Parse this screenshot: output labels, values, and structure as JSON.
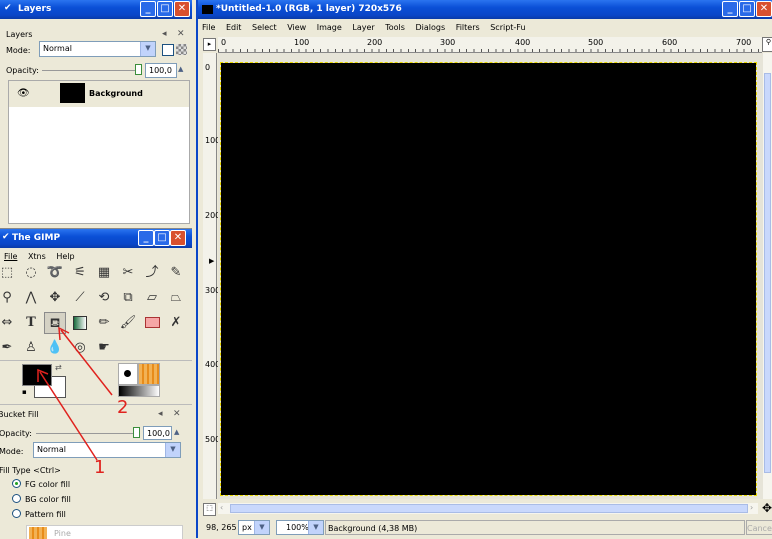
{
  "layers_window": {
    "title": "Layers",
    "header": "Layers",
    "mode_label": "Mode:",
    "mode_value": "Normal",
    "opacity_label": "Opacity:",
    "opacity_value": "100,0",
    "layer_name": "Background"
  },
  "toolbox_window": {
    "title": "The GIMP",
    "menu": [
      "File",
      "Xtns",
      "Help"
    ],
    "tools": [
      "rect-select",
      "ellipse-select",
      "free-select",
      "fuzzy-select",
      "color-select",
      "scissors",
      "paths",
      "color-picker",
      "zoom",
      "measure",
      "move",
      "crop",
      "rotate",
      "scale",
      "shear",
      "perspective",
      "flip",
      "text",
      "bucket-fill",
      "blend",
      "pencil",
      "paintbrush",
      "eraser",
      "airbrush",
      "ink",
      "clone",
      "blur",
      "dodge-burn",
      "smudge"
    ]
  },
  "tool_options": {
    "title": "Bucket Fill",
    "opacity_label": "Opacity:",
    "opacity_value": "100,0",
    "mode_label": "Mode:",
    "mode_value": "Normal",
    "filltype_label": "Fill Type  <Ctrl>",
    "fill_options": [
      "FG color fill",
      "BG color fill",
      "Pattern fill"
    ],
    "selected_fill": "FG color fill",
    "pattern_name": "Pine"
  },
  "image_window": {
    "title": "*Untitled-1.0 (RGB, 1 layer) 720x576",
    "menu": [
      "File",
      "Edit",
      "Select",
      "View",
      "Image",
      "Layer",
      "Tools",
      "Dialogs",
      "Filters",
      "Script-Fu"
    ],
    "ruler_h": [
      "0",
      "100",
      "200",
      "300",
      "400",
      "500",
      "600",
      "700"
    ],
    "ruler_v": [
      "0",
      "100",
      "200",
      "300",
      "400",
      "500"
    ],
    "status": {
      "coords": "98, 265",
      "unit": "px",
      "zoom": "100%",
      "info": "Background (4,38 MB)",
      "cancel": "Cancel"
    }
  },
  "annotations": [
    "1",
    "2"
  ],
  "colors": {
    "title_blue": "#0a46c8",
    "canvas": "#000000",
    "annotation": "#e0221e"
  }
}
